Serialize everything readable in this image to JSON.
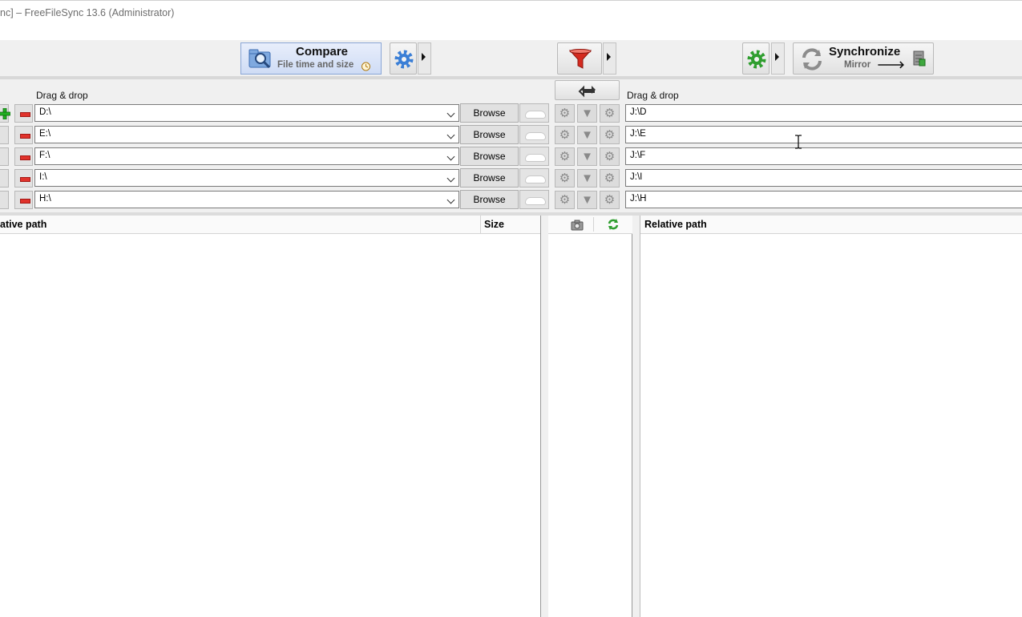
{
  "window": {
    "title": "nc] – FreeFileSync 13.6 (Administrator)"
  },
  "toolbar": {
    "compare": {
      "label": "Compare",
      "sublabel": "File time and size"
    },
    "synchronize": {
      "label": "Synchronize",
      "sublabel": "Mirror",
      "sublabel_arrow": "🡒"
    }
  },
  "left": {
    "drag_drop_label": "Drag & drop",
    "browse_label": "Browse",
    "folders": [
      "D:\\",
      "E:\\",
      "F:\\",
      "I:\\",
      "H:\\"
    ],
    "columns": {
      "relative_path": "ative path",
      "size": "Size"
    }
  },
  "right": {
    "drag_drop_label": "Drag & drop",
    "folders": [
      "J:\\D",
      "J:\\E",
      "J:\\F",
      "J:\\I",
      "J:\\H"
    ],
    "columns": {
      "relative_path": "Relative path"
    }
  },
  "icons": {
    "compare": "magnifier-folder-icon",
    "compare_settings": "gear-icon",
    "filter": "funnel-icon",
    "sync_settings": "gear-icon",
    "synchronize": "sync-arrows-icon",
    "swap_sides": "swap-icon",
    "cloud": "cloud-icon",
    "add_pair": "plus-icon",
    "remove_pair": "minus-icon"
  },
  "colors": {
    "compare_gear": "#3b7fd6",
    "filter_red": "#d42a1f",
    "sync_gear": "#2f9e2f",
    "add_green": "#22b022",
    "remove_red": "#e0322b"
  }
}
